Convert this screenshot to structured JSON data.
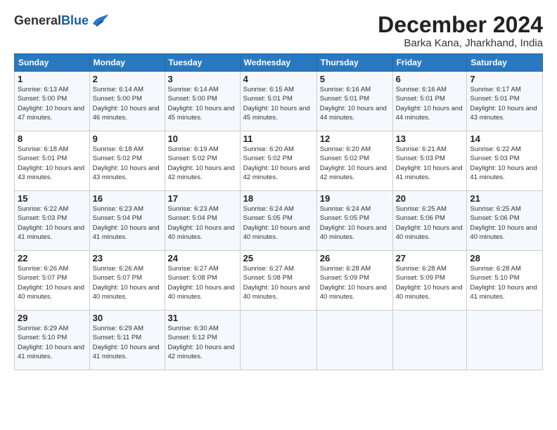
{
  "logo": {
    "text_general": "General",
    "text_blue": "Blue"
  },
  "header": {
    "month": "December 2024",
    "location": "Barka Kana, Jharkhand, India"
  },
  "weekdays": [
    "Sunday",
    "Monday",
    "Tuesday",
    "Wednesday",
    "Thursday",
    "Friday",
    "Saturday"
  ],
  "weeks": [
    [
      {
        "day": "1",
        "sunrise": "6:13 AM",
        "sunset": "5:00 PM",
        "daylight": "10 hours and 47 minutes."
      },
      {
        "day": "2",
        "sunrise": "6:14 AM",
        "sunset": "5:00 PM",
        "daylight": "10 hours and 46 minutes."
      },
      {
        "day": "3",
        "sunrise": "6:14 AM",
        "sunset": "5:00 PM",
        "daylight": "10 hours and 45 minutes."
      },
      {
        "day": "4",
        "sunrise": "6:15 AM",
        "sunset": "5:01 PM",
        "daylight": "10 hours and 45 minutes."
      },
      {
        "day": "5",
        "sunrise": "6:16 AM",
        "sunset": "5:01 PM",
        "daylight": "10 hours and 44 minutes."
      },
      {
        "day": "6",
        "sunrise": "6:16 AM",
        "sunset": "5:01 PM",
        "daylight": "10 hours and 44 minutes."
      },
      {
        "day": "7",
        "sunrise": "6:17 AM",
        "sunset": "5:01 PM",
        "daylight": "10 hours and 43 minutes."
      }
    ],
    [
      {
        "day": "8",
        "sunrise": "6:18 AM",
        "sunset": "5:01 PM",
        "daylight": "10 hours and 43 minutes."
      },
      {
        "day": "9",
        "sunrise": "6:18 AM",
        "sunset": "5:02 PM",
        "daylight": "10 hours and 43 minutes."
      },
      {
        "day": "10",
        "sunrise": "6:19 AM",
        "sunset": "5:02 PM",
        "daylight": "10 hours and 42 minutes."
      },
      {
        "day": "11",
        "sunrise": "6:20 AM",
        "sunset": "5:02 PM",
        "daylight": "10 hours and 42 minutes."
      },
      {
        "day": "12",
        "sunrise": "6:20 AM",
        "sunset": "5:02 PM",
        "daylight": "10 hours and 42 minutes."
      },
      {
        "day": "13",
        "sunrise": "6:21 AM",
        "sunset": "5:03 PM",
        "daylight": "10 hours and 41 minutes."
      },
      {
        "day": "14",
        "sunrise": "6:22 AM",
        "sunset": "5:03 PM",
        "daylight": "10 hours and 41 minutes."
      }
    ],
    [
      {
        "day": "15",
        "sunrise": "6:22 AM",
        "sunset": "5:03 PM",
        "daylight": "10 hours and 41 minutes."
      },
      {
        "day": "16",
        "sunrise": "6:23 AM",
        "sunset": "5:04 PM",
        "daylight": "10 hours and 41 minutes."
      },
      {
        "day": "17",
        "sunrise": "6:23 AM",
        "sunset": "5:04 PM",
        "daylight": "10 hours and 40 minutes."
      },
      {
        "day": "18",
        "sunrise": "6:24 AM",
        "sunset": "5:05 PM",
        "daylight": "10 hours and 40 minutes."
      },
      {
        "day": "19",
        "sunrise": "6:24 AM",
        "sunset": "5:05 PM",
        "daylight": "10 hours and 40 minutes."
      },
      {
        "day": "20",
        "sunrise": "6:25 AM",
        "sunset": "5:06 PM",
        "daylight": "10 hours and 40 minutes."
      },
      {
        "day": "21",
        "sunrise": "6:25 AM",
        "sunset": "5:06 PM",
        "daylight": "10 hours and 40 minutes."
      }
    ],
    [
      {
        "day": "22",
        "sunrise": "6:26 AM",
        "sunset": "5:07 PM",
        "daylight": "10 hours and 40 minutes."
      },
      {
        "day": "23",
        "sunrise": "6:26 AM",
        "sunset": "5:07 PM",
        "daylight": "10 hours and 40 minutes."
      },
      {
        "day": "24",
        "sunrise": "6:27 AM",
        "sunset": "5:08 PM",
        "daylight": "10 hours and 40 minutes."
      },
      {
        "day": "25",
        "sunrise": "6:27 AM",
        "sunset": "5:08 PM",
        "daylight": "10 hours and 40 minutes."
      },
      {
        "day": "26",
        "sunrise": "6:28 AM",
        "sunset": "5:09 PM",
        "daylight": "10 hours and 40 minutes."
      },
      {
        "day": "27",
        "sunrise": "6:28 AM",
        "sunset": "5:09 PM",
        "daylight": "10 hours and 40 minutes."
      },
      {
        "day": "28",
        "sunrise": "6:28 AM",
        "sunset": "5:10 PM",
        "daylight": "10 hours and 41 minutes."
      }
    ],
    [
      {
        "day": "29",
        "sunrise": "6:29 AM",
        "sunset": "5:10 PM",
        "daylight": "10 hours and 41 minutes."
      },
      {
        "day": "30",
        "sunrise": "6:29 AM",
        "sunset": "5:11 PM",
        "daylight": "10 hours and 41 minutes."
      },
      {
        "day": "31",
        "sunrise": "6:30 AM",
        "sunset": "5:12 PM",
        "daylight": "10 hours and 42 minutes."
      },
      null,
      null,
      null,
      null
    ]
  ]
}
